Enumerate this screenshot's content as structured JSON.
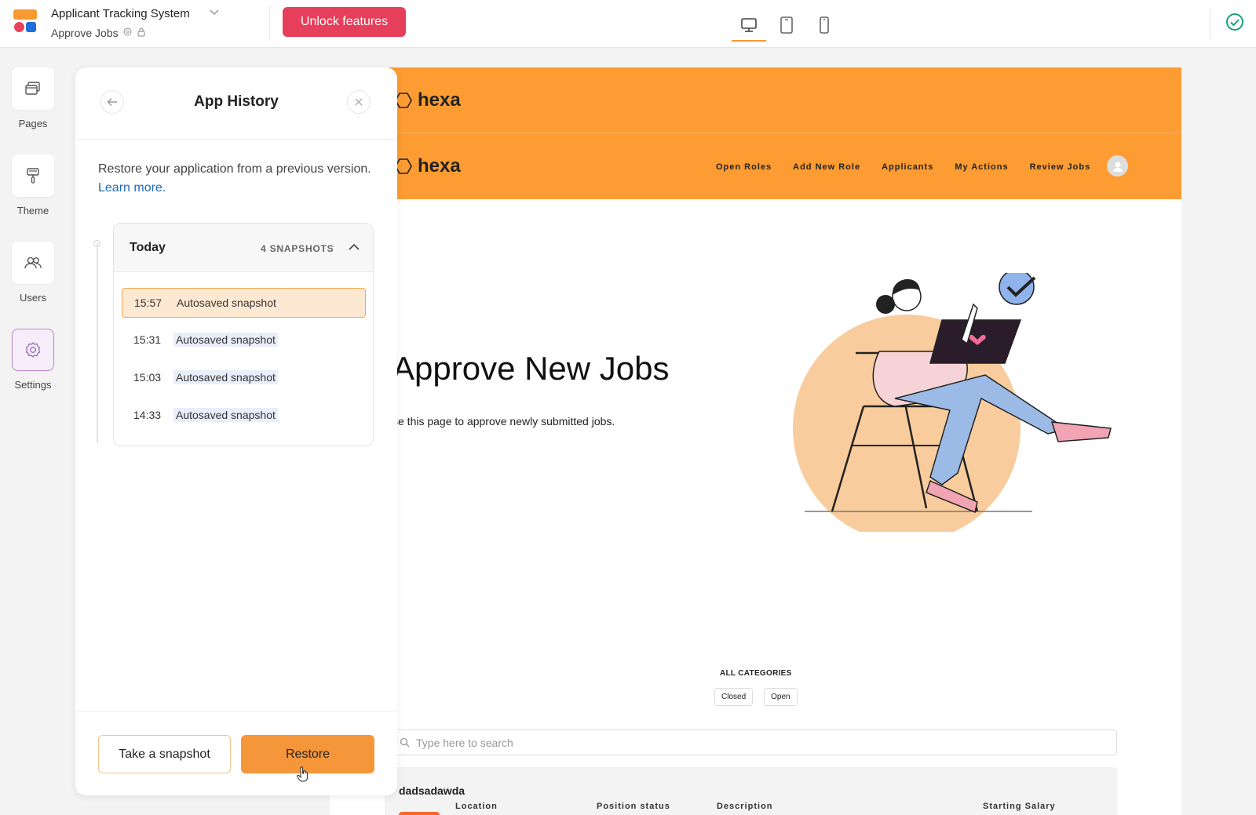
{
  "topbar": {
    "app_title": "Applicant Tracking System",
    "page_name": "Approve Jobs",
    "unlock_label": "Unlock features",
    "devices": [
      "desktop-icon",
      "tablet-icon",
      "mobile-icon"
    ],
    "active_device": "desktop",
    "status": "check-circle-icon"
  },
  "colors": {
    "brand_orange": "#fd9c32",
    "unlock_red": "#e63f5b",
    "restore_orange": "#f5963a",
    "selected_snapshot_bg": "#fde9d2",
    "link_blue": "#1e6bb8"
  },
  "sidebar": {
    "items": [
      {
        "label": "Pages",
        "icon": "pages-icon"
      },
      {
        "label": "Theme",
        "icon": "paint-roller-icon"
      },
      {
        "label": "Users",
        "icon": "users-icon"
      },
      {
        "label": "Settings",
        "icon": "gear-icon",
        "active": true
      }
    ]
  },
  "history": {
    "title": "App History",
    "description": "Restore your application from a previous version.",
    "learn_more": "Learn more.",
    "group": {
      "title": "Today",
      "count": "4 SNAPSHOTS",
      "expanded": true
    },
    "snapshots": [
      {
        "time": "15:57",
        "label": "Autosaved snapshot",
        "selected": true
      },
      {
        "time": "15:31",
        "label": "Autosaved snapshot",
        "selected": false
      },
      {
        "time": "15:03",
        "label": "Autosaved snapshot",
        "selected": false
      },
      {
        "time": "14:33",
        "label": "Autosaved snapshot",
        "selected": false
      }
    ],
    "take_snapshot_label": "Take a snapshot",
    "restore_label": "Restore"
  },
  "preview": {
    "logo_text": "hexa",
    "nav": [
      "Open Roles",
      "Add New Role",
      "Applicants",
      "My Actions",
      "Review Jobs"
    ],
    "hero_title": "Approve New Jobs",
    "hero_subtitle": "se this page to approve newly submitted jobs.",
    "categories_label": "ALL CATEGORIES",
    "categories": [
      "Closed",
      "Open"
    ],
    "search_placeholder": "Type here to search",
    "job": {
      "name": "dadsadawda",
      "columns": [
        "Location",
        "Position status",
        "Description",
        "Starting Salary"
      ]
    }
  }
}
